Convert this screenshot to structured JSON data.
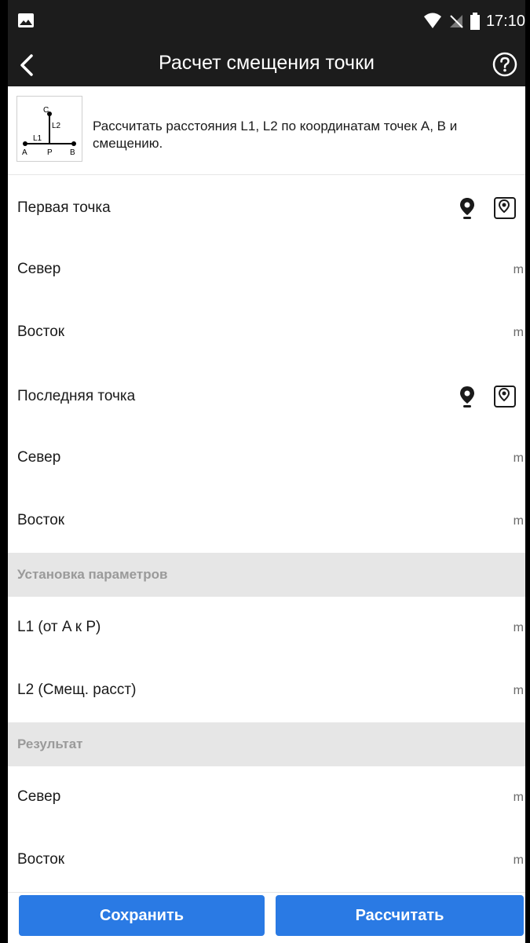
{
  "status": {
    "time": "17:10"
  },
  "header": {
    "title": "Расчет смещения точки"
  },
  "description": {
    "text": "Рассчитать расстояния L1, L2 по координатам точек A, B и смещению.",
    "thumb_labels": {
      "c": "C",
      "l1": "L1",
      "l2": "L2",
      "a": "A",
      "p": "P",
      "b": "B"
    }
  },
  "first_point": {
    "title": "Первая точка",
    "north": {
      "label": "Север",
      "value": "",
      "unit": "m"
    },
    "east": {
      "label": "Восток",
      "value": "",
      "unit": "m"
    }
  },
  "last_point": {
    "title": "Последняя точка",
    "north": {
      "label": "Север",
      "value": "",
      "unit": "m"
    },
    "east": {
      "label": "Восток",
      "value": "",
      "unit": "m"
    }
  },
  "params": {
    "title": "Установка параметров",
    "l1": {
      "label": "L1 (от A к P)",
      "value": "",
      "unit": "m"
    },
    "l2": {
      "label": "L2 (Смещ. расст)",
      "value": "",
      "unit": "m"
    }
  },
  "result": {
    "title": "Результат",
    "north": {
      "label": "Север",
      "value": "",
      "unit": "m"
    },
    "east": {
      "label": "Восток",
      "value": "",
      "unit": "m"
    }
  },
  "buttons": {
    "save": "Сохранить",
    "calculate": "Рассчитать"
  },
  "colors": {
    "accent": "#2a7ae4",
    "bar": "#1c1c1c",
    "band": "#e6e6e6"
  }
}
